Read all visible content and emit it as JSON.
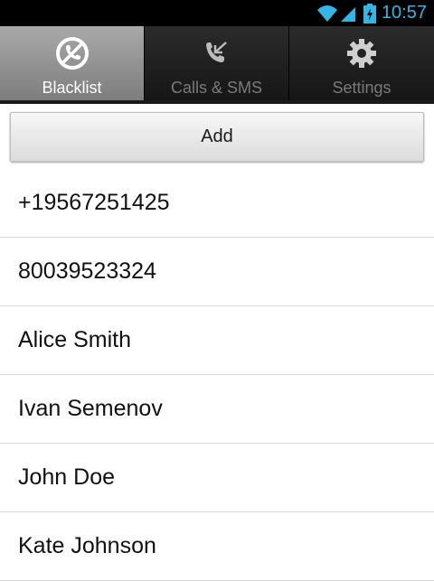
{
  "status_bar": {
    "time": "10:57",
    "icons": [
      "wifi-icon",
      "signal-icon",
      "battery-charging-icon"
    ],
    "accent_color": "#33b5e5"
  },
  "tabs": [
    {
      "label": "Blacklist",
      "icon": "blocked-call-icon",
      "selected": true
    },
    {
      "label": "Calls & SMS",
      "icon": "missed-call-icon",
      "selected": false
    },
    {
      "label": "Settings",
      "icon": "gear-icon",
      "selected": false
    }
  ],
  "add_button": {
    "label": "Add"
  },
  "blacklist": [
    "+19567251425",
    "80039523324",
    "Alice Smith",
    "Ivan Semenov",
    "John Doe",
    "Kate Johnson"
  ]
}
